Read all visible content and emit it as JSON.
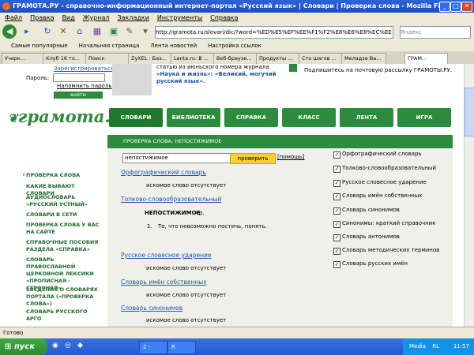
{
  "window": {
    "title": "ГРАМОТА.РУ - справочно-информационный интернет-портал «Русский язык» | Словари | Проверка слова - Mozilla Firefox",
    "min_label": "_",
    "max_label": "□",
    "close_label": "✕"
  },
  "menu": [
    "Файл",
    "Правка",
    "Вид",
    "Журнал",
    "Закладки",
    "Инструменты",
    "Справка"
  ],
  "url": "http://gramota.ru/slovari/dic/?word=%ED%E5%EF%EE%F1%F2%E8%E6%E8%EC%EE",
  "search_placeholder": "Яндекс",
  "bookmarks": [
    "Самые популярные",
    "Начальная страница",
    "Лента новостей",
    "Настройка ссылок"
  ],
  "tabs": [
    "Учерк...",
    "Клуб 16 то...",
    "Поиск",
    "ZyXEL : Баз...",
    "Lenta.ru: В ...",
    "Веб-браузе...",
    "Продукты ...",
    "Сто шагов ...",
    "Меладзе Ва...",
    "ГРАМ..."
  ],
  "header": {
    "registered_label": "Зарегистрироваться",
    "password_label": "Пароль:",
    "remind_label": "Напомнить пароль",
    "login_label": "войти",
    "news_line1": "статью из июньского номера журнала",
    "news_line2": "«Наука и жизнь»: «Великий, могучий",
    "news_line3": "русский язык».",
    "subscribe_text": "Подпишитесь на почтовую рассылку ГРАМОТЫ.РУ."
  },
  "logo": "грамота.ру",
  "navtabs": [
    "СЛОВАРИ",
    "БИБЛИОТЕКА",
    "СПРАВКА",
    "КЛАСС",
    "ЛЕНТА",
    "ИГРА"
  ],
  "breadcrumb": "ПРОВЕРКА СЛОВА: НЕПОСТИЖИМОЕ",
  "left_links": [
    "ПРОВЕРКА СЛОВА",
    "КАКИЕ БЫВАЮТ СЛОВАРИ",
    "АУДИОСЛОВАРЬ «РУССКИЙ УСТНЫЙ»",
    "СЛОВАРИ В СЕТИ",
    "ПРОВЕРКА СЛОВА У ВАС НА САЙТЕ",
    "СПРАВОЧНЫЕ ПОСОБИЯ РАЗДЕЛА «СПРАВКА»",
    "СЛОВАРЬ ПРАВОСЛАВНОЙ ЦЕРКОВНОЙ ЛЕКСИКИ «ПРОПИСНАЯ – СТРОЧНАЯ»",
    "СВЕДЕНИЯ О СЛОВАРЯХ ПОРТАЛА («ПРОВЕРКА СЛОВА»)",
    "СЛОВАРЬ РУССКОГО АРГО"
  ],
  "search": {
    "value": "непостижимое",
    "button": "проверить",
    "help": "[помощь]"
  },
  "results": {
    "orth": "Орфографический словарь",
    "not_found": "искомое слово отсутствует",
    "tolk": "Толково-словообразовательный",
    "entry_word": "НЕПОСТИЖИМОЕ",
    "entry_pos": "ср.",
    "def_num": "1.",
    "def_text": "То, что невозможно постичь, понять.",
    "stress": "Русское словесное ударение",
    "names": "Словарь имён собственных",
    "syn": "Словарь синонимов"
  },
  "checkboxes": [
    "Орфографический словарь",
    "Толково-словообразовательный",
    "Русское словесное ударение",
    "Словарь имён собственных",
    "Словарь синонимов",
    "Синонимы: краткий справочник",
    "Словарь антонимов",
    "Словарь методических терминов",
    "Словарь русских имён"
  ],
  "checkmark": "✓",
  "status": "Готово",
  "taskbar": {
    "start": "пуск",
    "items": [
      "2 ·",
      "R"
    ],
    "tray_media": "Media",
    "tray_lang": "RL",
    "time": "11:57"
  }
}
